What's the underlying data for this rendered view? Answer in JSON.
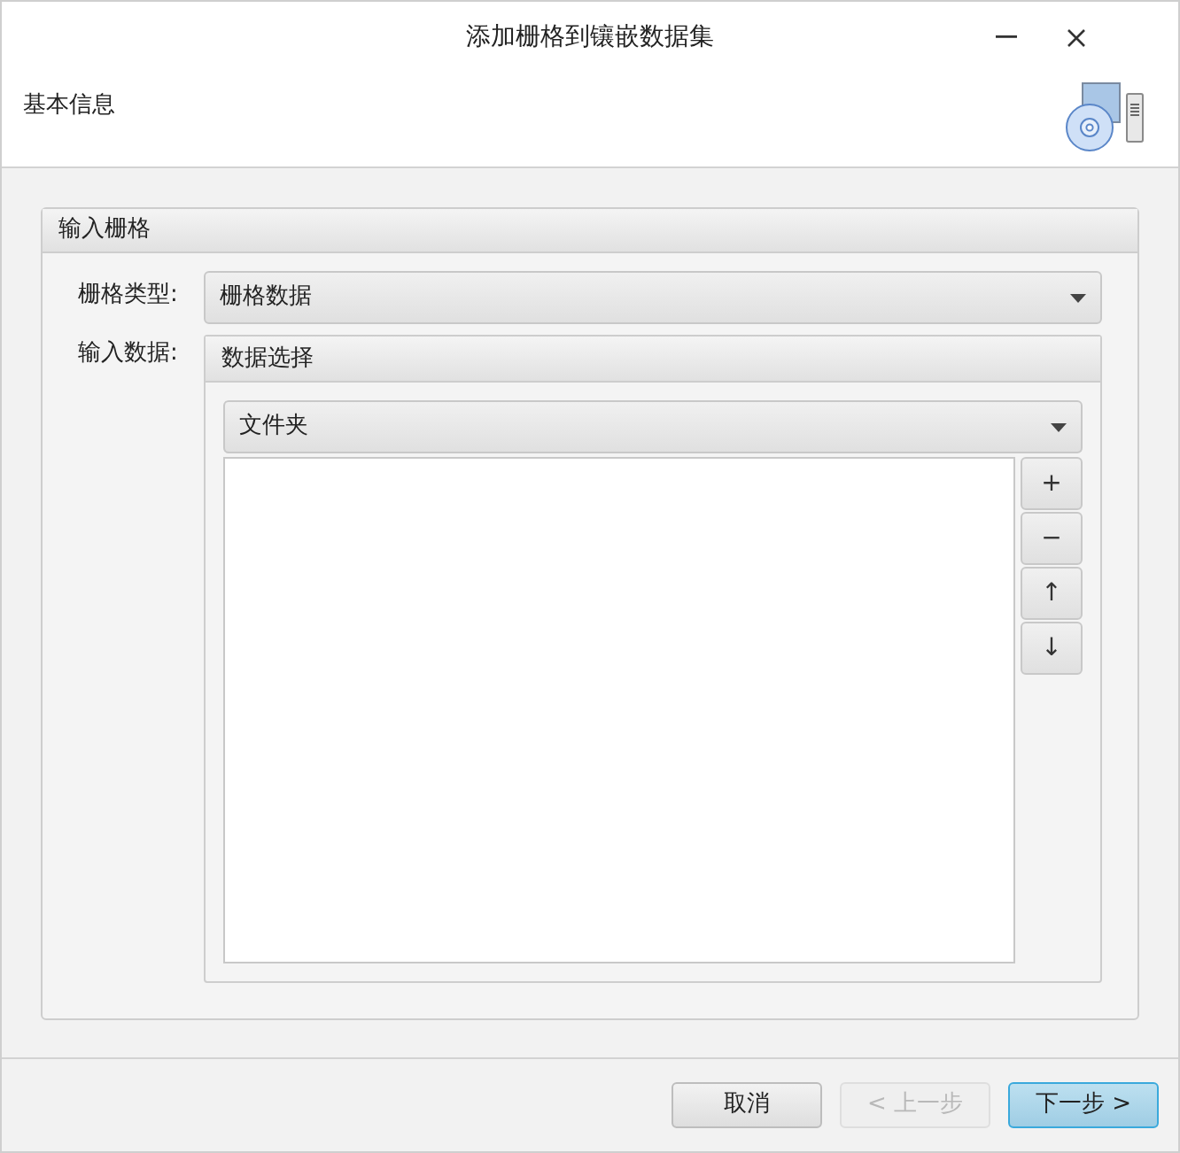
{
  "window": {
    "title": "添加栅格到镶嵌数据集"
  },
  "header": {
    "title": "基本信息"
  },
  "section": {
    "title": "输入栅格",
    "raster_type": {
      "label": "栅格类型:",
      "value": "栅格数据"
    },
    "input_data": {
      "label": "输入数据:",
      "group_title": "数据选择",
      "source": "文件夹",
      "side_buttons": [
        {
          "label": "+"
        },
        {
          "label": "−"
        },
        {
          "label": "↑"
        },
        {
          "label": "↓"
        }
      ]
    }
  },
  "buttons": [
    {
      "label": "取消",
      "disabled": false,
      "default": false
    },
    {
      "label": "< 上一步",
      "disabled": true,
      "default": false
    },
    {
      "label": "下一步 >",
      "disabled": false,
      "default": true
    }
  ]
}
